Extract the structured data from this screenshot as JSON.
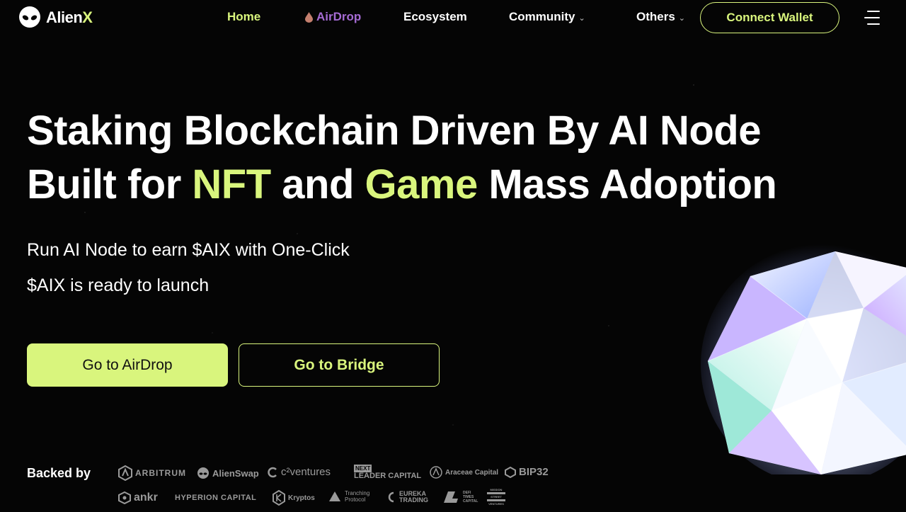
{
  "brand": {
    "name_main": "Alien",
    "name_accent": "X"
  },
  "nav": {
    "items": [
      {
        "label": "Home"
      },
      {
        "label": "AirDrop"
      },
      {
        "label": "Ecosystem"
      },
      {
        "label": "Community"
      },
      {
        "label": "Others"
      }
    ],
    "connect_label": "Connect Wallet"
  },
  "hero": {
    "line1": "Staking Blockchain Driven By AI Node",
    "line2_a": "Built for ",
    "line2_b": "NFT",
    "line2_c": " and ",
    "line2_d": "Game",
    "line2_e": " Mass Adoption",
    "sub1": "Run AI Node to earn $AIX with One-Click",
    "sub2": "$AIX is ready to launch",
    "btn_primary": "Go to AirDrop",
    "btn_secondary": "Go to Bridge"
  },
  "backers": {
    "label": "Backed by",
    "row1": [
      "ARBITRUM",
      "AlienSwap",
      "c²ventures",
      "NEXT",
      "LEADER CAPITAL",
      "Araceae Capital",
      "BIP32"
    ],
    "row2": [
      "ankr",
      "HYPERION CAPITAL",
      "Kryptos",
      "Tranching",
      "Protocol",
      "EUREKA",
      "TRADING",
      "DEFI",
      "TIMES",
      "CAPITAL",
      "MISSION",
      "STREET",
      "VENTURES"
    ]
  },
  "colors": {
    "accent": "#d9f57d",
    "airdrop": "#a56bd3",
    "background": "#050505"
  }
}
